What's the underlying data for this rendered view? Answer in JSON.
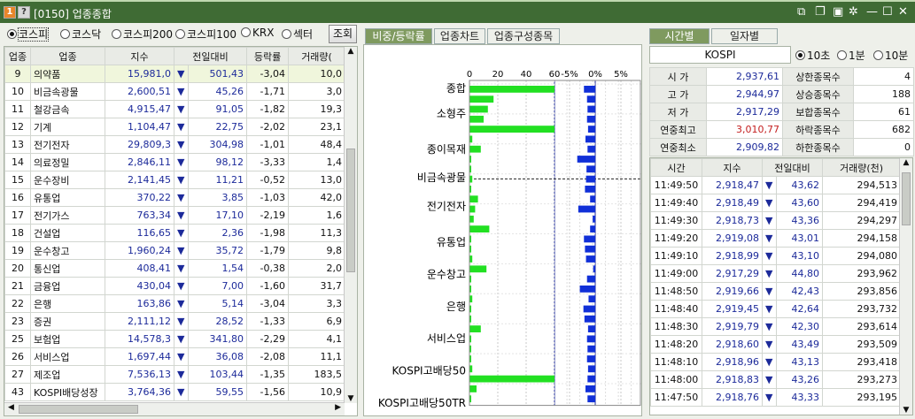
{
  "window": {
    "title": "[0150] 업종종합",
    "num_badge": "1",
    "help_badge": "?"
  },
  "market_radios": [
    {
      "label": "코스피",
      "on": true
    },
    {
      "label": "코스닥",
      "on": false
    },
    {
      "label": "코스피200",
      "on": false
    },
    {
      "label": "코스피100",
      "on": false
    },
    {
      "label": "KRX",
      "on": false
    },
    {
      "label": "섹터",
      "on": false
    }
  ],
  "query_button": "조회",
  "sector_table": {
    "headers": [
      "업종",
      "업종",
      "지수",
      "전일대비",
      "등락률",
      "거래량("
    ],
    "rows": [
      [
        "9",
        "의약품",
        "15,981,0",
        "▼",
        "501,43",
        "-3,04",
        "10,0"
      ],
      [
        "10",
        "비금속광물",
        "2,600,51",
        "▼",
        "45,26",
        "-1,71",
        "3,0"
      ],
      [
        "11",
        "철강금속",
        "4,915,47",
        "▼",
        "91,05",
        "-1,82",
        "19,3"
      ],
      [
        "12",
        "기계",
        "1,104,47",
        "▼",
        "22,75",
        "-2,02",
        "23,1"
      ],
      [
        "13",
        "전기전자",
        "29,809,3",
        "▼",
        "304,98",
        "-1,01",
        "48,4"
      ],
      [
        "14",
        "의료정밀",
        "2,846,11",
        "▼",
        "98,12",
        "-3,33",
        "1,4"
      ],
      [
        "15",
        "운수장비",
        "2,141,45",
        "▼",
        "11,21",
        "-0,52",
        "13,0"
      ],
      [
        "16",
        "유통업",
        "370,22",
        "▼",
        "3,85",
        "-1,03",
        "42,0"
      ],
      [
        "17",
        "전기가스",
        "763,34",
        "▼",
        "17,10",
        "-2,19",
        "1,6"
      ],
      [
        "18",
        "건설업",
        "116,65",
        "▼",
        "2,36",
        "-1,98",
        "11,3"
      ],
      [
        "19",
        "운수창고",
        "1,960,24",
        "▼",
        "35,72",
        "-1,79",
        "9,8"
      ],
      [
        "20",
        "통신업",
        "408,41",
        "▼",
        "1,54",
        "-0,38",
        "2,0"
      ],
      [
        "21",
        "금융업",
        "430,04",
        "▼",
        "7,00",
        "-1,60",
        "31,7"
      ],
      [
        "22",
        "은행",
        "163,86",
        "▼",
        "5,14",
        "-3,04",
        "3,3"
      ],
      [
        "23",
        "증권",
        "2,111,12",
        "▼",
        "28,52",
        "-1,33",
        "6,9"
      ],
      [
        "25",
        "보험업",
        "14,578,3",
        "▼",
        "341,80",
        "-2,29",
        "4,1"
      ],
      [
        "26",
        "서비스업",
        "1,697,44",
        "▼",
        "36,08",
        "-2,08",
        "11,1"
      ],
      [
        "27",
        "제조업",
        "7,536,13",
        "▼",
        "103,44",
        "-1,35",
        "183,5"
      ],
      [
        "43",
        "KOSPI배당성장",
        "3,764,36",
        "▼",
        "59,55",
        "-1,56",
        "10,9"
      ]
    ]
  },
  "middle_tabs": [
    "비중/등락률",
    "업종차트",
    "업종구성종목"
  ],
  "chart_data": {
    "type": "bar",
    "axis_left_ticks": [
      "0",
      "20",
      "40",
      "60"
    ],
    "axis_right_ticks": [
      "-5%",
      "0%",
      "5%"
    ],
    "category_labels": [
      "종합",
      "소형주",
      "종이목재",
      "비금속광물",
      "전기전자",
      "유통업",
      "운수창고",
      "은행",
      "서비스업",
      "KOSPI고배당50",
      "KOSPI고배당50TR"
    ],
    "weight_series": {
      "name": "",
      "color": "#22e022",
      "values": [
        60,
        17,
        13,
        10,
        60,
        2,
        8,
        0.5,
        0.5,
        2,
        1,
        6,
        4,
        3,
        14,
        0.5,
        0.5,
        2,
        12,
        0.5,
        0.5,
        2,
        1,
        0.5,
        8,
        0.5,
        1,
        0.5,
        2,
        60,
        5,
        0.5
      ]
    },
    "change_series": {
      "name": "",
      "color": "#1130d8",
      "values": [
        -2.2,
        -1.6,
        -1.5,
        -1.6,
        -1.4,
        -1.9,
        -1.5,
        -3.5,
        -1.7,
        -1.8,
        -2.0,
        -1.0,
        -3.3,
        -0.5,
        -1.0,
        -2.2,
        -2.0,
        -1.8,
        -0.4,
        -1.6,
        -3.0,
        -1.3,
        -2.3,
        -2.1,
        -1.4,
        -1.6,
        -1.5,
        -1.6,
        -1.4,
        -1.5,
        -1.9,
        -1.5
      ]
    }
  },
  "right_tabs": [
    "시간별",
    "일자별"
  ],
  "index_name": "KOSPI",
  "interval_radios": [
    {
      "label": "10초",
      "on": true
    },
    {
      "label": "1분",
      "on": false
    },
    {
      "label": "10분",
      "on": false
    }
  ],
  "summary": [
    {
      "l": "시 가",
      "v": "2,937,61",
      "l2": "상한종목수",
      "v2": "4",
      "red": false
    },
    {
      "l": "고 가",
      "v": "2,944,97",
      "l2": "상승종목수",
      "v2": "188",
      "red": false
    },
    {
      "l": "저 가",
      "v": "2,917,29",
      "l2": "보합종목수",
      "v2": "61",
      "red": false
    },
    {
      "l": "연중최고",
      "v": "3,010,77",
      "l2": "하락종목수",
      "v2": "682",
      "red": true
    },
    {
      "l": "연중최소",
      "v": "2,909,82",
      "l2": "하한종목수",
      "v2": "0",
      "red": false
    }
  ],
  "time_table": {
    "headers": [
      "시간",
      "지수",
      "전일대비",
      "거래량(천)"
    ],
    "rows": [
      [
        "11:49:50",
        "2,918,47",
        "▼",
        "43,62",
        "294,513"
      ],
      [
        "11:49:40",
        "2,918,49",
        "▼",
        "43,60",
        "294,419"
      ],
      [
        "11:49:30",
        "2,918,73",
        "▼",
        "43,36",
        "294,297"
      ],
      [
        "11:49:20",
        "2,919,08",
        "▼",
        "43,01",
        "294,158"
      ],
      [
        "11:49:10",
        "2,918,99",
        "▼",
        "43,10",
        "294,080"
      ],
      [
        "11:49:00",
        "2,917,29",
        "▼",
        "44,80",
        "293,962"
      ],
      [
        "11:48:50",
        "2,919,66",
        "▼",
        "42,43",
        "293,856"
      ],
      [
        "11:48:40",
        "2,919,45",
        "▼",
        "42,64",
        "293,732"
      ],
      [
        "11:48:30",
        "2,919,79",
        "▼",
        "42,30",
        "293,614"
      ],
      [
        "11:48:20",
        "2,918,60",
        "▼",
        "43,49",
        "293,509"
      ],
      [
        "11:48:10",
        "2,918,96",
        "▼",
        "43,13",
        "293,418"
      ],
      [
        "11:48:00",
        "2,918,83",
        "▼",
        "43,26",
        "293,273"
      ],
      [
        "11:47:50",
        "2,918,76",
        "▼",
        "43,33",
        "293,195"
      ]
    ]
  }
}
